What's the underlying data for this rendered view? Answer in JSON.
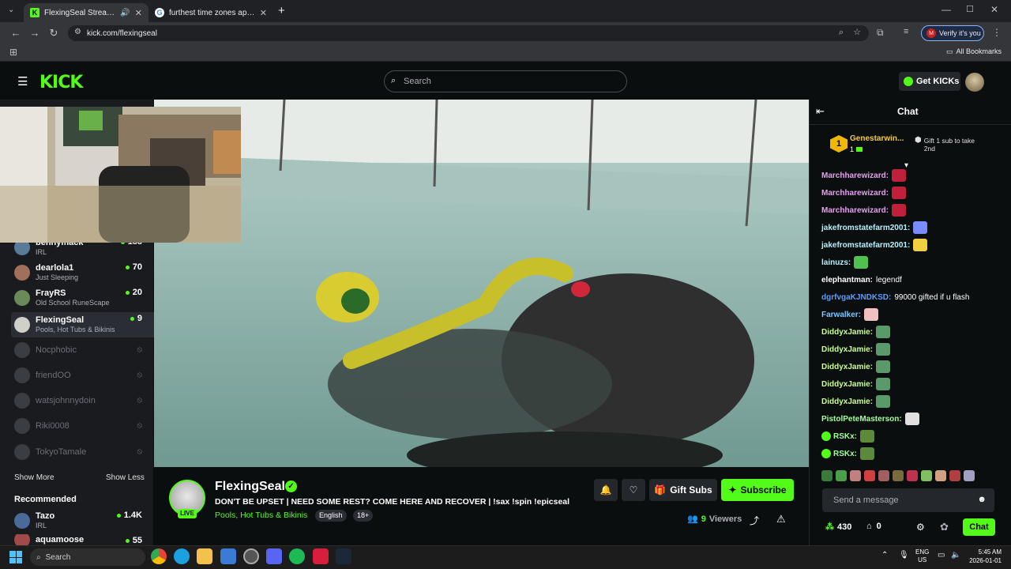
{
  "browser": {
    "tabs": [
      {
        "title": "FlexingSeal Stream - Watch",
        "active": true
      },
      {
        "title": "furthest time zones apart - Go",
        "active": false
      }
    ],
    "url": "kick.com/flexingseal",
    "verify_label": "Verify it's you",
    "bookmarks_label": "All Bookmarks"
  },
  "header": {
    "logo": "KICK",
    "search_placeholder": "Search",
    "get_kicks_label": "Get KICKs"
  },
  "sidebar": {
    "channels": [
      {
        "name": "bennymack",
        "category": "IRL",
        "viewers": "188"
      },
      {
        "name": "dearlola1",
        "category": "Just Sleeping",
        "viewers": "70"
      },
      {
        "name": "FrayRS",
        "category": "Old School RuneScape",
        "viewers": "20"
      },
      {
        "name": "FlexingSeal",
        "category": "Pools, Hot Tubs & Bikinis",
        "viewers": "9"
      },
      {
        "name": "Nocphobic"
      },
      {
        "name": "friendOO"
      },
      {
        "name": "watsjohnnydoin"
      },
      {
        "name": "Riki0008"
      },
      {
        "name": "TokyoTamale"
      }
    ],
    "show_more": "Show More",
    "show_less": "Show Less",
    "recommended_title": "Recommended",
    "recommended": [
      {
        "name": "Tazo",
        "category": "IRL",
        "viewers": "1.4K"
      },
      {
        "name": "aquamoose",
        "viewers": "55"
      }
    ]
  },
  "stream": {
    "streamer": "FlexingSeal",
    "live_badge": "LIVE",
    "title": "DON'T BE UPSET | NEED SOME REST? COME HERE AND RECOVER | !sax !spin !epicseal",
    "category": "Pools, Hot Tubs & Bikinis",
    "tags": [
      "English",
      "18+"
    ],
    "viewers": "9",
    "viewers_label": "Viewers",
    "gift_subs_label": "Gift Subs",
    "subscribe_label": "Subscribe"
  },
  "chat": {
    "title": "Chat",
    "pinned_user": "Genestarwin...",
    "pinned_rank": "1",
    "pinned_count": "1",
    "gift_prompt_line1": "Gift 1 sub to take",
    "gift_prompt_line2": "2nd",
    "messages": [
      {
        "user": "Marchharewizard:",
        "text": "",
        "color": "#e6a0f0"
      },
      {
        "user": "Marchharewizard:",
        "text": "",
        "color": "#e6a0f0"
      },
      {
        "user": "Marchharewizard:",
        "text": "",
        "color": "#e6a0f0"
      },
      {
        "user": "jakefromstatefarm2001:",
        "text": "",
        "color": "#b6f0ff"
      },
      {
        "user": "jakefromstatefarm2001:",
        "text": "",
        "color": "#b6f0ff"
      },
      {
        "user": "lainuzs:",
        "text": "",
        "color": "#b6f0ff"
      },
      {
        "user": "elephantman:",
        "text": "legendf",
        "color": "#ffffff"
      },
      {
        "user": "dgrfvgaKJNDKSD:",
        "text": "99000 gifted if u flash",
        "color": "#5b9cff"
      },
      {
        "user": "Farwalker:",
        "text": "",
        "color": "#7cc7ff"
      },
      {
        "user": "DiddyxJamie:",
        "text": "",
        "color": "#caff8f"
      },
      {
        "user": "DiddyxJamie:",
        "text": "",
        "color": "#caff8f"
      },
      {
        "user": "DiddyxJamie:",
        "text": "",
        "color": "#caff8f"
      },
      {
        "user": "DiddyxJamie:",
        "text": "",
        "color": "#caff8f"
      },
      {
        "user": "DiddyxJamie:",
        "text": "",
        "color": "#caff8f"
      },
      {
        "user": "PistolPeteMasterson:",
        "text": "",
        "color": "#a0ff9a"
      },
      {
        "user": "RSKx:",
        "text": "",
        "color": "#a0ff9a"
      },
      {
        "user": "RSKx:",
        "text": "",
        "color": "#a0ff9a"
      }
    ],
    "input_placeholder": "Send a message",
    "points": "430",
    "store_count": "0",
    "send_label": "Chat"
  },
  "taskbar": {
    "search_placeholder": "Search",
    "lang_line1": "ENG",
    "lang_line2": "US",
    "time": "5:45 AM",
    "date": "2026-01-01"
  },
  "colors": {
    "accent": "#53fc18"
  }
}
